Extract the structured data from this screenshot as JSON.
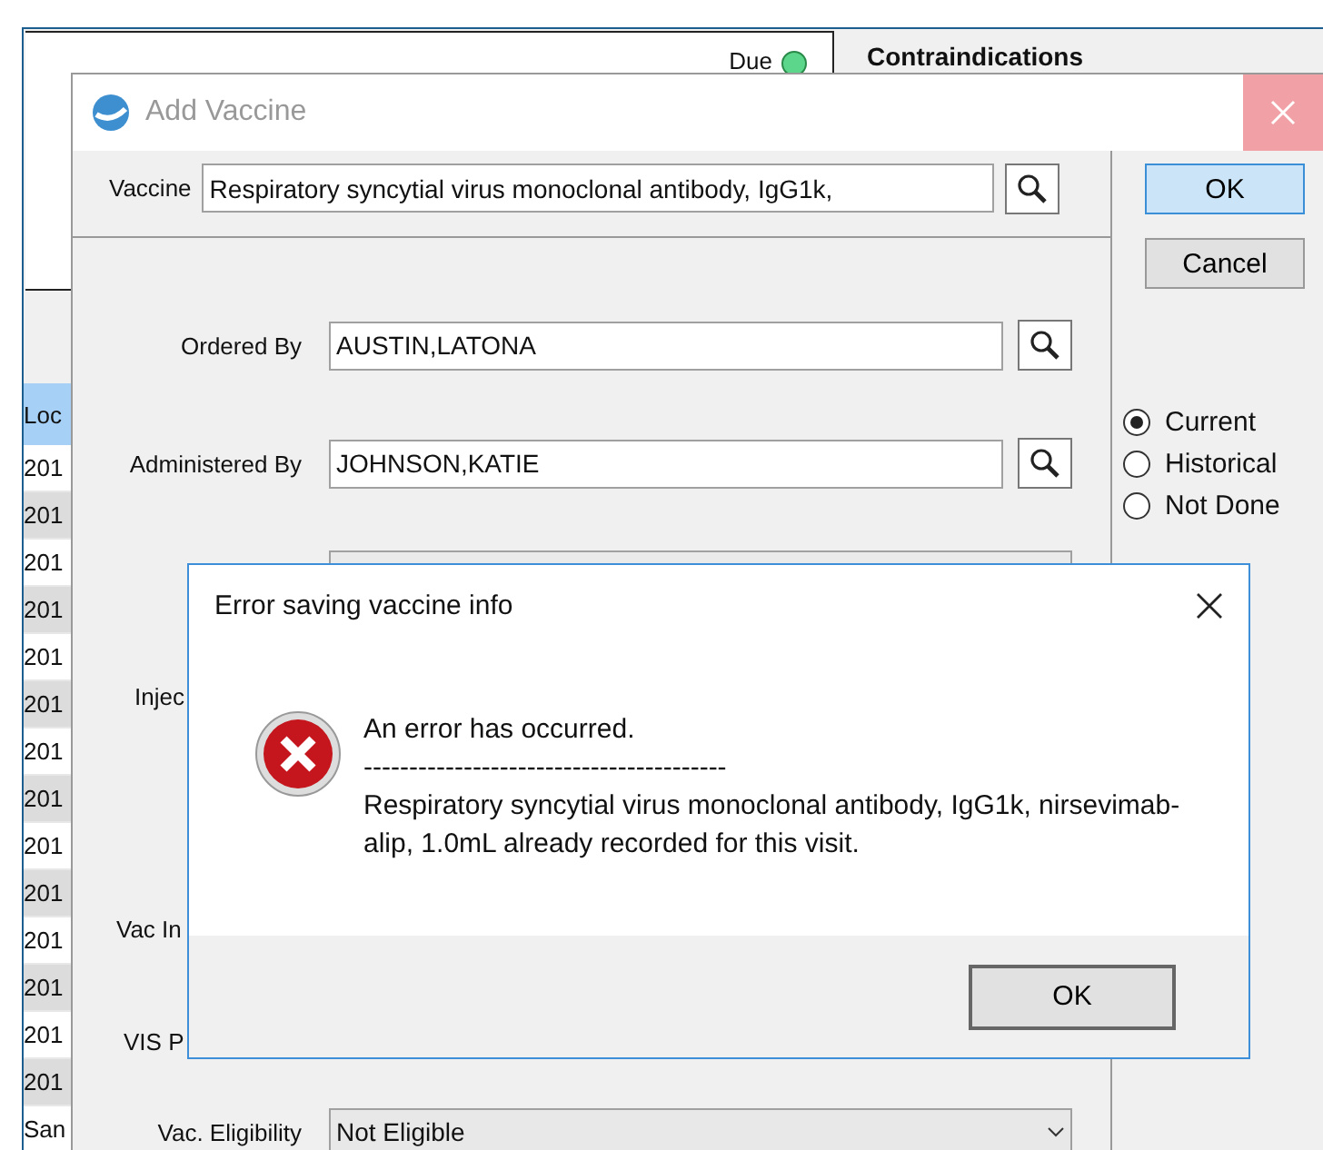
{
  "background_window": {
    "status_label": "Due",
    "heading": "Contraindications",
    "table": {
      "column_header": "Loc",
      "rows": [
        "201",
        "201",
        "201",
        "201",
        "201",
        "201",
        "201",
        "201",
        "201",
        "201",
        "201",
        "201",
        "201",
        "201",
        "San"
      ]
    }
  },
  "add_vaccine_dialog": {
    "title": "Add Vaccine",
    "active": false,
    "vaccine": {
      "label": "Vaccine",
      "value": "Respiratory syncytial virus monoclonal antibody, IgG1k,"
    },
    "fields": [
      {
        "kind": "lookup",
        "label": "Ordered By",
        "value": "AUSTIN,LATONA"
      },
      {
        "kind": "lookup",
        "label": "Administered By",
        "value": "JOHNSON,KATIE"
      },
      {
        "kind": "disabled"
      },
      {
        "kind": "label",
        "label": "Injec"
      },
      {
        "kind": "label",
        "label": "Vac In"
      },
      {
        "kind": "label",
        "label": "VIS P"
      },
      {
        "kind": "select",
        "label": "Vac. Eligibility",
        "value": "Not Eligible"
      }
    ],
    "buttons": [
      {
        "label": "OK",
        "default": true
      },
      {
        "label": "Cancel",
        "default": false
      }
    ],
    "status_options": [
      {
        "label": "Current",
        "selected": true
      },
      {
        "label": "Historical",
        "selected": false
      },
      {
        "label": "Not Done",
        "selected": false
      }
    ]
  },
  "error_dialog": {
    "title": "Error saving vaccine info",
    "heading": "An error has occurred.",
    "separator": "----------------------------------------",
    "message": "Respiratory syncytial virus monoclonal antibody, IgG1k, nirsevimab-alip, 1.0mL already recorded for this visit.",
    "button": "OK"
  }
}
